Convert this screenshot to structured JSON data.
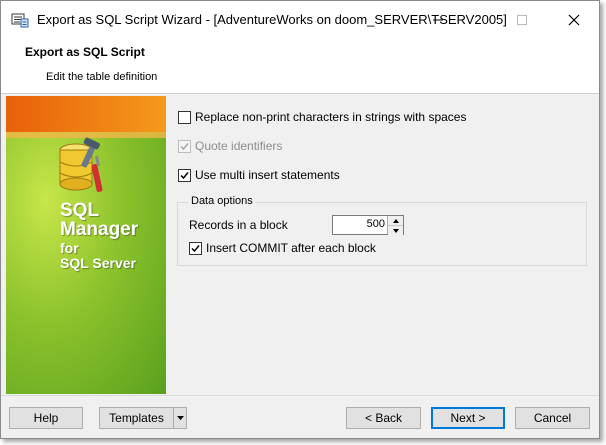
{
  "window": {
    "title": "Export as SQL Script Wizard - [AdventureWorks on doom_SERVER\\TSERV2005]"
  },
  "header": {
    "title": "Export as SQL Script",
    "subtitle": "Edit the table definition"
  },
  "sidebar": {
    "brand_line1": "SQL",
    "brand_line2": "Manager",
    "brand_line3": "for",
    "brand_line4": "SQL Server"
  },
  "options": {
    "replace_nonprint": {
      "label": "Replace non-print characters in strings with spaces",
      "checked": false
    },
    "quote_identifiers": {
      "label": "Quote identifiers",
      "checked": true,
      "disabled": true
    },
    "multi_insert": {
      "label": "Use multi insert statements",
      "checked": true
    }
  },
  "data_options": {
    "legend": "Data options",
    "records_label": "Records in a block",
    "records_value": "500",
    "insert_commit": {
      "label": "Insert COMMIT after each block",
      "checked": true
    }
  },
  "buttons": {
    "help": "Help",
    "templates": "Templates",
    "back": "< Back",
    "next": "Next >",
    "cancel": "Cancel"
  },
  "colors": {
    "accent": "#0078d7",
    "sidebar_green": "#8cc22c",
    "sidebar_orange": "#e8600a"
  },
  "icons": {
    "app": "wizard-app-icon",
    "minimize": "minimize-icon",
    "maximize": "maximize-icon",
    "close": "close-icon",
    "logo": "database-tools-icon"
  }
}
